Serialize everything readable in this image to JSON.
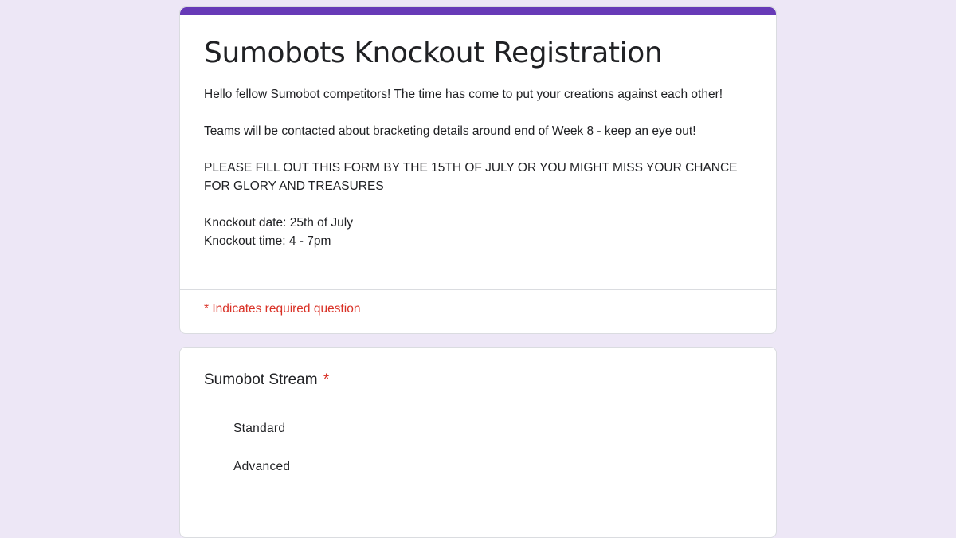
{
  "form": {
    "title": "Sumobots Knockout Registration",
    "description": {
      "paragraph1": "Hello fellow Sumobot competitors! The time has come to put your creations against each other!",
      "paragraph2": "Teams will be contacted about bracketing details around end of Week 8 - keep an eye out!",
      "paragraph3": "PLEASE FILL OUT THIS FORM BY THE 15TH OF JULY OR YOU MIGHT MISS YOUR CHANCE FOR GLORY AND TREASURES",
      "knockout_date": "Knockout date: 25th of July",
      "knockout_time": "Knockout time: 4 - 7pm"
    },
    "required_note": "* Indicates required question"
  },
  "question": {
    "title": "Sumobot Stream",
    "required_marker": "*",
    "options": [
      {
        "label": "Standard"
      },
      {
        "label": "Advanced"
      }
    ]
  },
  "colors": {
    "accent": "#673ab7",
    "background": "#ede7f6",
    "required": "#d93025"
  }
}
